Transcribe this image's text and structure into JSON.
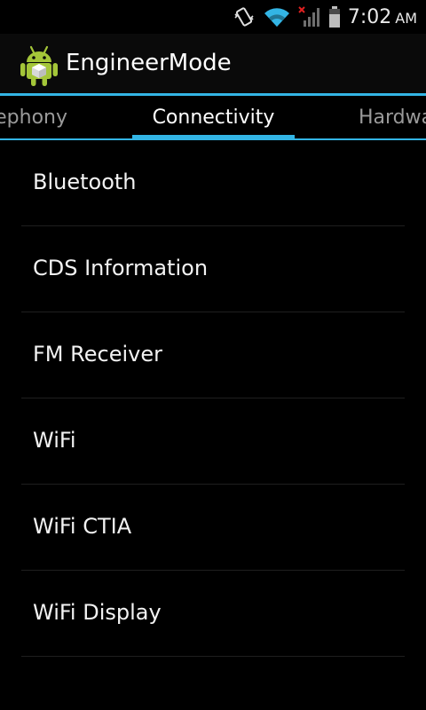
{
  "status_bar": {
    "time": "7:02",
    "ampm": "AM",
    "icons": [
      "vibrate-icon",
      "wifi-icon",
      "signal-no-service-icon",
      "battery-icon"
    ]
  },
  "action_bar": {
    "title": "EngineerMode",
    "icon": "android-icon"
  },
  "tabs": {
    "left": "Telephony",
    "center": "Connectivity",
    "right": "Hardware",
    "selected": "Connectivity"
  },
  "list": {
    "items": [
      {
        "label": "Bluetooth"
      },
      {
        "label": "CDS Information"
      },
      {
        "label": "FM Receiver"
      },
      {
        "label": "WiFi"
      },
      {
        "label": "WiFi CTIA"
      },
      {
        "label": "WiFi Display"
      }
    ]
  },
  "colors": {
    "accent": "#33b5e5",
    "background": "#000000"
  }
}
